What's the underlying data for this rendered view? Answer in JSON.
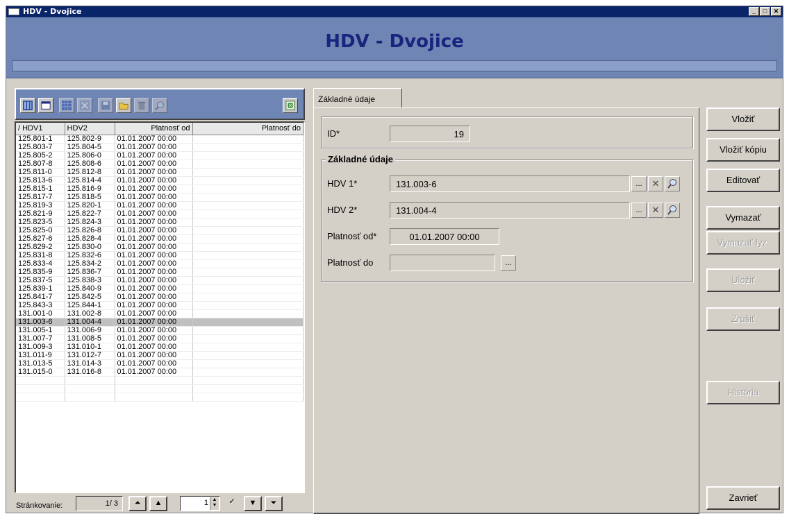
{
  "window": {
    "title": "HDV - Dvojice",
    "minimize": "_",
    "maximize": "□",
    "close": "✕"
  },
  "header": {
    "title": "HDV - Dvojice"
  },
  "grid": {
    "columns": [
      "/ HDV1",
      "HDV2",
      "Platnosť od",
      "Platnosť do"
    ],
    "rows": [
      [
        "125.801-1",
        "125.802-9",
        "01.01.2007 00:00",
        ""
      ],
      [
        "125.803-7",
        "125.804-5",
        "01.01.2007 00:00",
        ""
      ],
      [
        "125.805-2",
        "125.806-0",
        "01.01.2007 00:00",
        ""
      ],
      [
        "125.807-8",
        "125.808-6",
        "01.01.2007 00:00",
        ""
      ],
      [
        "125.811-0",
        "125.812-8",
        "01.01.2007 00:00",
        ""
      ],
      [
        "125.813-6",
        "125.814-4",
        "01.01.2007 00:00",
        ""
      ],
      [
        "125.815-1",
        "125.816-9",
        "01.01.2007 00:00",
        ""
      ],
      [
        "125.817-7",
        "125.818-5",
        "01.01.2007 00:00",
        ""
      ],
      [
        "125.819-3",
        "125.820-1",
        "01.01.2007 00:00",
        ""
      ],
      [
        "125.821-9",
        "125.822-7",
        "01.01.2007 00:00",
        ""
      ],
      [
        "125.823-5",
        "125.824-3",
        "01.01.2007 00:00",
        ""
      ],
      [
        "125.825-0",
        "125.826-8",
        "01.01.2007 00:00",
        ""
      ],
      [
        "125.827-6",
        "125.828-4",
        "01.01.2007 00:00",
        ""
      ],
      [
        "125.829-2",
        "125.830-0",
        "01.01.2007 00:00",
        ""
      ],
      [
        "125.831-8",
        "125.832-6",
        "01.01.2007 00:00",
        ""
      ],
      [
        "125.833-4",
        "125.834-2",
        "01.01.2007 00:00",
        ""
      ],
      [
        "125.835-9",
        "125.836-7",
        "01.01.2007 00:00",
        ""
      ],
      [
        "125.837-5",
        "125.838-3",
        "01.01.2007 00:00",
        ""
      ],
      [
        "125.839-1",
        "125.840-9",
        "01.01.2007 00:00",
        ""
      ],
      [
        "125.841-7",
        "125.842-5",
        "01.01.2007 00:00",
        ""
      ],
      [
        "125.843-3",
        "125.844-1",
        "01.01.2007 00:00",
        ""
      ],
      [
        "131.001-0",
        "131.002-8",
        "01.01.2007 00:00",
        ""
      ],
      [
        "131.003-6",
        "131.004-4",
        "01.01.2007 00:00",
        ""
      ],
      [
        "131.005-1",
        "131.006-9",
        "01.01.2007 00:00",
        ""
      ],
      [
        "131.007-7",
        "131.008-5",
        "01.01.2007 00:00",
        ""
      ],
      [
        "131.009-3",
        "131.010-1",
        "01.01.2007 00:00",
        ""
      ],
      [
        "131.011-9",
        "131.012-7",
        "01.01.2007 00:00",
        ""
      ],
      [
        "131.013-5",
        "131.014-3",
        "01.01.2007 00:00",
        ""
      ],
      [
        "131.015-0",
        "131.016-8",
        "01.01.2007 00:00",
        ""
      ]
    ],
    "selected_row": 22
  },
  "pager": {
    "label": "Stránkovanie:",
    "page_display": "1/ 3",
    "page_input": "1"
  },
  "tab": {
    "label": "Základné údaje"
  },
  "form": {
    "id_label": "ID*",
    "id_value": "19",
    "group_title": "Základné údaje",
    "hdv1_label": "HDV 1*",
    "hdv1_value": "131.003-6",
    "hdv2_label": "HDV 2*",
    "hdv2_value": "131.004-4",
    "from_label": "Platnosť od*",
    "from_value": "01.01.2007 00:00",
    "to_label": "Platnosť do",
    "to_value": "",
    "ellipsis": "...",
    "clear_glyph": "✕"
  },
  "actions": {
    "insert": "Vložiť",
    "insert_copy": "Vložiť kópiu",
    "edit": "Editovať",
    "delete": "Vymazať",
    "delete_phys": "Vymazať fyz.",
    "save": "Uložiť",
    "cancel": "Zrušiť",
    "history": "História",
    "close": "Zavrieť"
  }
}
